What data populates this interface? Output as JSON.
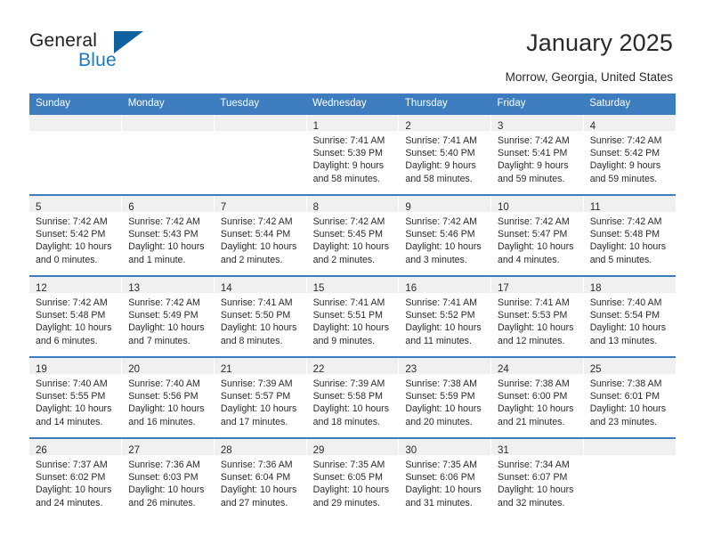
{
  "brand": {
    "name_top": "General",
    "name_bottom": "Blue",
    "accent_color": "#1b79c3",
    "triangle_color": "#10619f"
  },
  "header": {
    "title": "January 2025",
    "location": "Morrow, Georgia, United States",
    "header_bg": "#3d7dbf",
    "daynum_band_bg": "#f0f0f0"
  },
  "calendar": {
    "weekday_headers": [
      "Sunday",
      "Monday",
      "Tuesday",
      "Wednesday",
      "Thursday",
      "Friday",
      "Saturday"
    ],
    "weeks": [
      [
        {
          "empty": true
        },
        {
          "empty": true
        },
        {
          "empty": true
        },
        {
          "day": "1",
          "sunrise": "Sunrise: 7:41 AM",
          "sunset": "Sunset: 5:39 PM",
          "daylight_line1": "Daylight: 9 hours",
          "daylight_line2": "and 58 minutes."
        },
        {
          "day": "2",
          "sunrise": "Sunrise: 7:41 AM",
          "sunset": "Sunset: 5:40 PM",
          "daylight_line1": "Daylight: 9 hours",
          "daylight_line2": "and 58 minutes."
        },
        {
          "day": "3",
          "sunrise": "Sunrise: 7:42 AM",
          "sunset": "Sunset: 5:41 PM",
          "daylight_line1": "Daylight: 9 hours",
          "daylight_line2": "and 59 minutes."
        },
        {
          "day": "4",
          "sunrise": "Sunrise: 7:42 AM",
          "sunset": "Sunset: 5:42 PM",
          "daylight_line1": "Daylight: 9 hours",
          "daylight_line2": "and 59 minutes."
        }
      ],
      [
        {
          "day": "5",
          "sunrise": "Sunrise: 7:42 AM",
          "sunset": "Sunset: 5:42 PM",
          "daylight_line1": "Daylight: 10 hours",
          "daylight_line2": "and 0 minutes."
        },
        {
          "day": "6",
          "sunrise": "Sunrise: 7:42 AM",
          "sunset": "Sunset: 5:43 PM",
          "daylight_line1": "Daylight: 10 hours",
          "daylight_line2": "and 1 minute."
        },
        {
          "day": "7",
          "sunrise": "Sunrise: 7:42 AM",
          "sunset": "Sunset: 5:44 PM",
          "daylight_line1": "Daylight: 10 hours",
          "daylight_line2": "and 2 minutes."
        },
        {
          "day": "8",
          "sunrise": "Sunrise: 7:42 AM",
          "sunset": "Sunset: 5:45 PM",
          "daylight_line1": "Daylight: 10 hours",
          "daylight_line2": "and 2 minutes."
        },
        {
          "day": "9",
          "sunrise": "Sunrise: 7:42 AM",
          "sunset": "Sunset: 5:46 PM",
          "daylight_line1": "Daylight: 10 hours",
          "daylight_line2": "and 3 minutes."
        },
        {
          "day": "10",
          "sunrise": "Sunrise: 7:42 AM",
          "sunset": "Sunset: 5:47 PM",
          "daylight_line1": "Daylight: 10 hours",
          "daylight_line2": "and 4 minutes."
        },
        {
          "day": "11",
          "sunrise": "Sunrise: 7:42 AM",
          "sunset": "Sunset: 5:48 PM",
          "daylight_line1": "Daylight: 10 hours",
          "daylight_line2": "and 5 minutes."
        }
      ],
      [
        {
          "day": "12",
          "sunrise": "Sunrise: 7:42 AM",
          "sunset": "Sunset: 5:48 PM",
          "daylight_line1": "Daylight: 10 hours",
          "daylight_line2": "and 6 minutes."
        },
        {
          "day": "13",
          "sunrise": "Sunrise: 7:42 AM",
          "sunset": "Sunset: 5:49 PM",
          "daylight_line1": "Daylight: 10 hours",
          "daylight_line2": "and 7 minutes."
        },
        {
          "day": "14",
          "sunrise": "Sunrise: 7:41 AM",
          "sunset": "Sunset: 5:50 PM",
          "daylight_line1": "Daylight: 10 hours",
          "daylight_line2": "and 8 minutes."
        },
        {
          "day": "15",
          "sunrise": "Sunrise: 7:41 AM",
          "sunset": "Sunset: 5:51 PM",
          "daylight_line1": "Daylight: 10 hours",
          "daylight_line2": "and 9 minutes."
        },
        {
          "day": "16",
          "sunrise": "Sunrise: 7:41 AM",
          "sunset": "Sunset: 5:52 PM",
          "daylight_line1": "Daylight: 10 hours",
          "daylight_line2": "and 11 minutes."
        },
        {
          "day": "17",
          "sunrise": "Sunrise: 7:41 AM",
          "sunset": "Sunset: 5:53 PM",
          "daylight_line1": "Daylight: 10 hours",
          "daylight_line2": "and 12 minutes."
        },
        {
          "day": "18",
          "sunrise": "Sunrise: 7:40 AM",
          "sunset": "Sunset: 5:54 PM",
          "daylight_line1": "Daylight: 10 hours",
          "daylight_line2": "and 13 minutes."
        }
      ],
      [
        {
          "day": "19",
          "sunrise": "Sunrise: 7:40 AM",
          "sunset": "Sunset: 5:55 PM",
          "daylight_line1": "Daylight: 10 hours",
          "daylight_line2": "and 14 minutes."
        },
        {
          "day": "20",
          "sunrise": "Sunrise: 7:40 AM",
          "sunset": "Sunset: 5:56 PM",
          "daylight_line1": "Daylight: 10 hours",
          "daylight_line2": "and 16 minutes."
        },
        {
          "day": "21",
          "sunrise": "Sunrise: 7:39 AM",
          "sunset": "Sunset: 5:57 PM",
          "daylight_line1": "Daylight: 10 hours",
          "daylight_line2": "and 17 minutes."
        },
        {
          "day": "22",
          "sunrise": "Sunrise: 7:39 AM",
          "sunset": "Sunset: 5:58 PM",
          "daylight_line1": "Daylight: 10 hours",
          "daylight_line2": "and 18 minutes."
        },
        {
          "day": "23",
          "sunrise": "Sunrise: 7:38 AM",
          "sunset": "Sunset: 5:59 PM",
          "daylight_line1": "Daylight: 10 hours",
          "daylight_line2": "and 20 minutes."
        },
        {
          "day": "24",
          "sunrise": "Sunrise: 7:38 AM",
          "sunset": "Sunset: 6:00 PM",
          "daylight_line1": "Daylight: 10 hours",
          "daylight_line2": "and 21 minutes."
        },
        {
          "day": "25",
          "sunrise": "Sunrise: 7:38 AM",
          "sunset": "Sunset: 6:01 PM",
          "daylight_line1": "Daylight: 10 hours",
          "daylight_line2": "and 23 minutes."
        }
      ],
      [
        {
          "day": "26",
          "sunrise": "Sunrise: 7:37 AM",
          "sunset": "Sunset: 6:02 PM",
          "daylight_line1": "Daylight: 10 hours",
          "daylight_line2": "and 24 minutes."
        },
        {
          "day": "27",
          "sunrise": "Sunrise: 7:36 AM",
          "sunset": "Sunset: 6:03 PM",
          "daylight_line1": "Daylight: 10 hours",
          "daylight_line2": "and 26 minutes."
        },
        {
          "day": "28",
          "sunrise": "Sunrise: 7:36 AM",
          "sunset": "Sunset: 6:04 PM",
          "daylight_line1": "Daylight: 10 hours",
          "daylight_line2": "and 27 minutes."
        },
        {
          "day": "29",
          "sunrise": "Sunrise: 7:35 AM",
          "sunset": "Sunset: 6:05 PM",
          "daylight_line1": "Daylight: 10 hours",
          "daylight_line2": "and 29 minutes."
        },
        {
          "day": "30",
          "sunrise": "Sunrise: 7:35 AM",
          "sunset": "Sunset: 6:06 PM",
          "daylight_line1": "Daylight: 10 hours",
          "daylight_line2": "and 31 minutes."
        },
        {
          "day": "31",
          "sunrise": "Sunrise: 7:34 AM",
          "sunset": "Sunset: 6:07 PM",
          "daylight_line1": "Daylight: 10 hours",
          "daylight_line2": "and 32 minutes."
        },
        {
          "empty": true
        }
      ]
    ]
  }
}
